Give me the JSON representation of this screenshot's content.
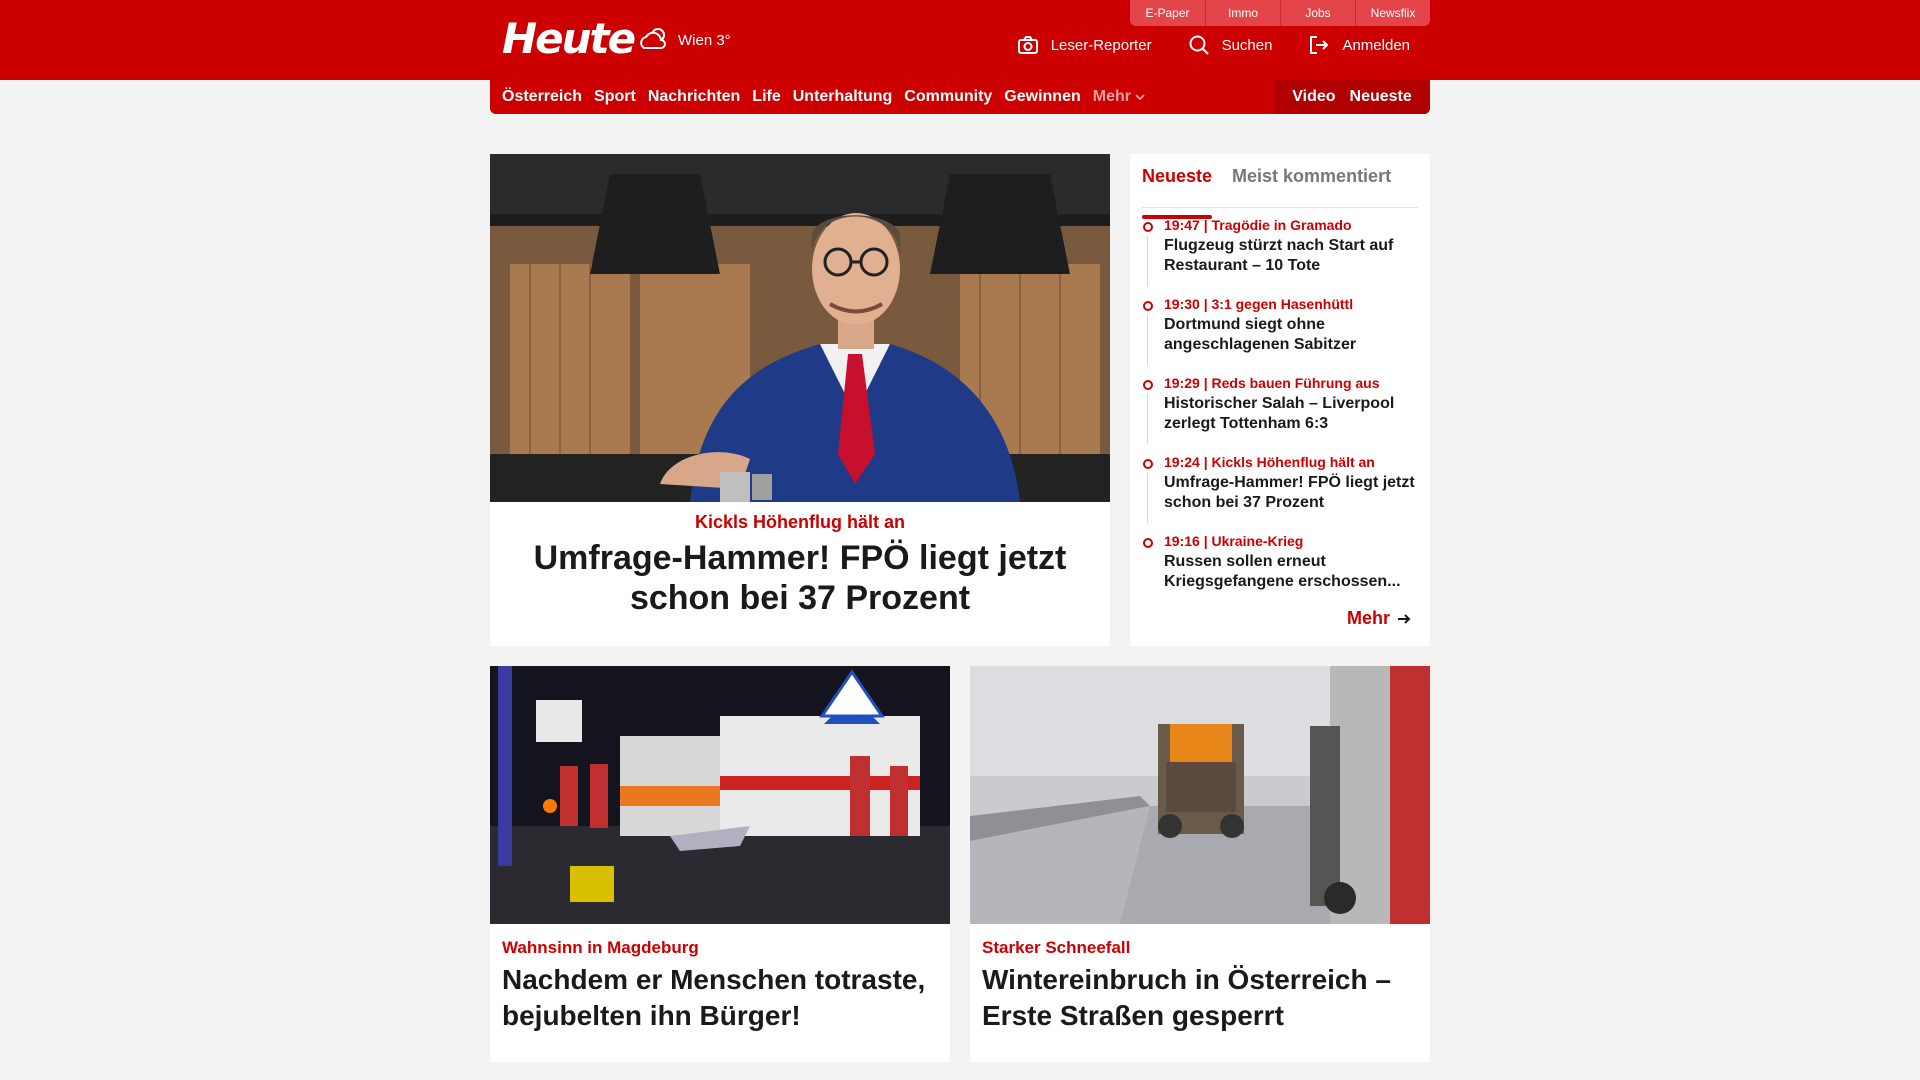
{
  "header": {
    "logo": "Heute",
    "weather": "Wien 3°",
    "services": [
      "E-Paper",
      "Immo",
      "Jobs",
      "Newsflix"
    ],
    "actions": {
      "reporter": "Leser-Reporter",
      "search": "Suchen",
      "login": "Anmelden"
    }
  },
  "nav": {
    "items": [
      "Österreich",
      "Sport",
      "Nachrichten",
      "Life",
      "Unterhaltung",
      "Community",
      "Gewinnen"
    ],
    "more": "Mehr",
    "video": "Video",
    "latest": "Neueste"
  },
  "hero": {
    "kicker": "Kickls Höhenflug hält an",
    "title": "Umfrage-Hammer! FPÖ liegt jetzt schon bei 37 Prozent"
  },
  "sidebar": {
    "tabs": [
      "Neueste",
      "Meist kommentiert"
    ],
    "items": [
      {
        "meta": "19:47 | Tragödie in Gramado",
        "title": "Flugzeug stürzt nach Start auf Restaurant – 10 Tote"
      },
      {
        "meta": "19:30 | 3:1 gegen Hasenhüttl",
        "title": "Dortmund siegt ohne angeschlagenen Sabitzer"
      },
      {
        "meta": "19:29 | Reds bauen Führung aus",
        "title": "Historischer Salah – Liverpool zerlegt Tottenham 6:3"
      },
      {
        "meta": "19:24 | Kickls Höhenflug hält an",
        "title": "Umfrage-Hammer! FPÖ liegt jetzt schon bei 37 Prozent"
      },
      {
        "meta": "19:16 | Ukraine-Krieg",
        "title": "Russen sollen erneut Kriegsgefangene erschossen..."
      }
    ],
    "more": "Mehr"
  },
  "cards": [
    {
      "kicker": "Wahnsinn in Magdeburg",
      "title": "Nachdem er Menschen totraste, bejubelten ihn Bürger!"
    },
    {
      "kicker": "Starker Schneefall",
      "title": "Wintereinbruch in Österreich – Erste Straßen gesperrt"
    }
  ],
  "colors": {
    "brand": "#cc0000",
    "background": "#f3f3f3"
  }
}
